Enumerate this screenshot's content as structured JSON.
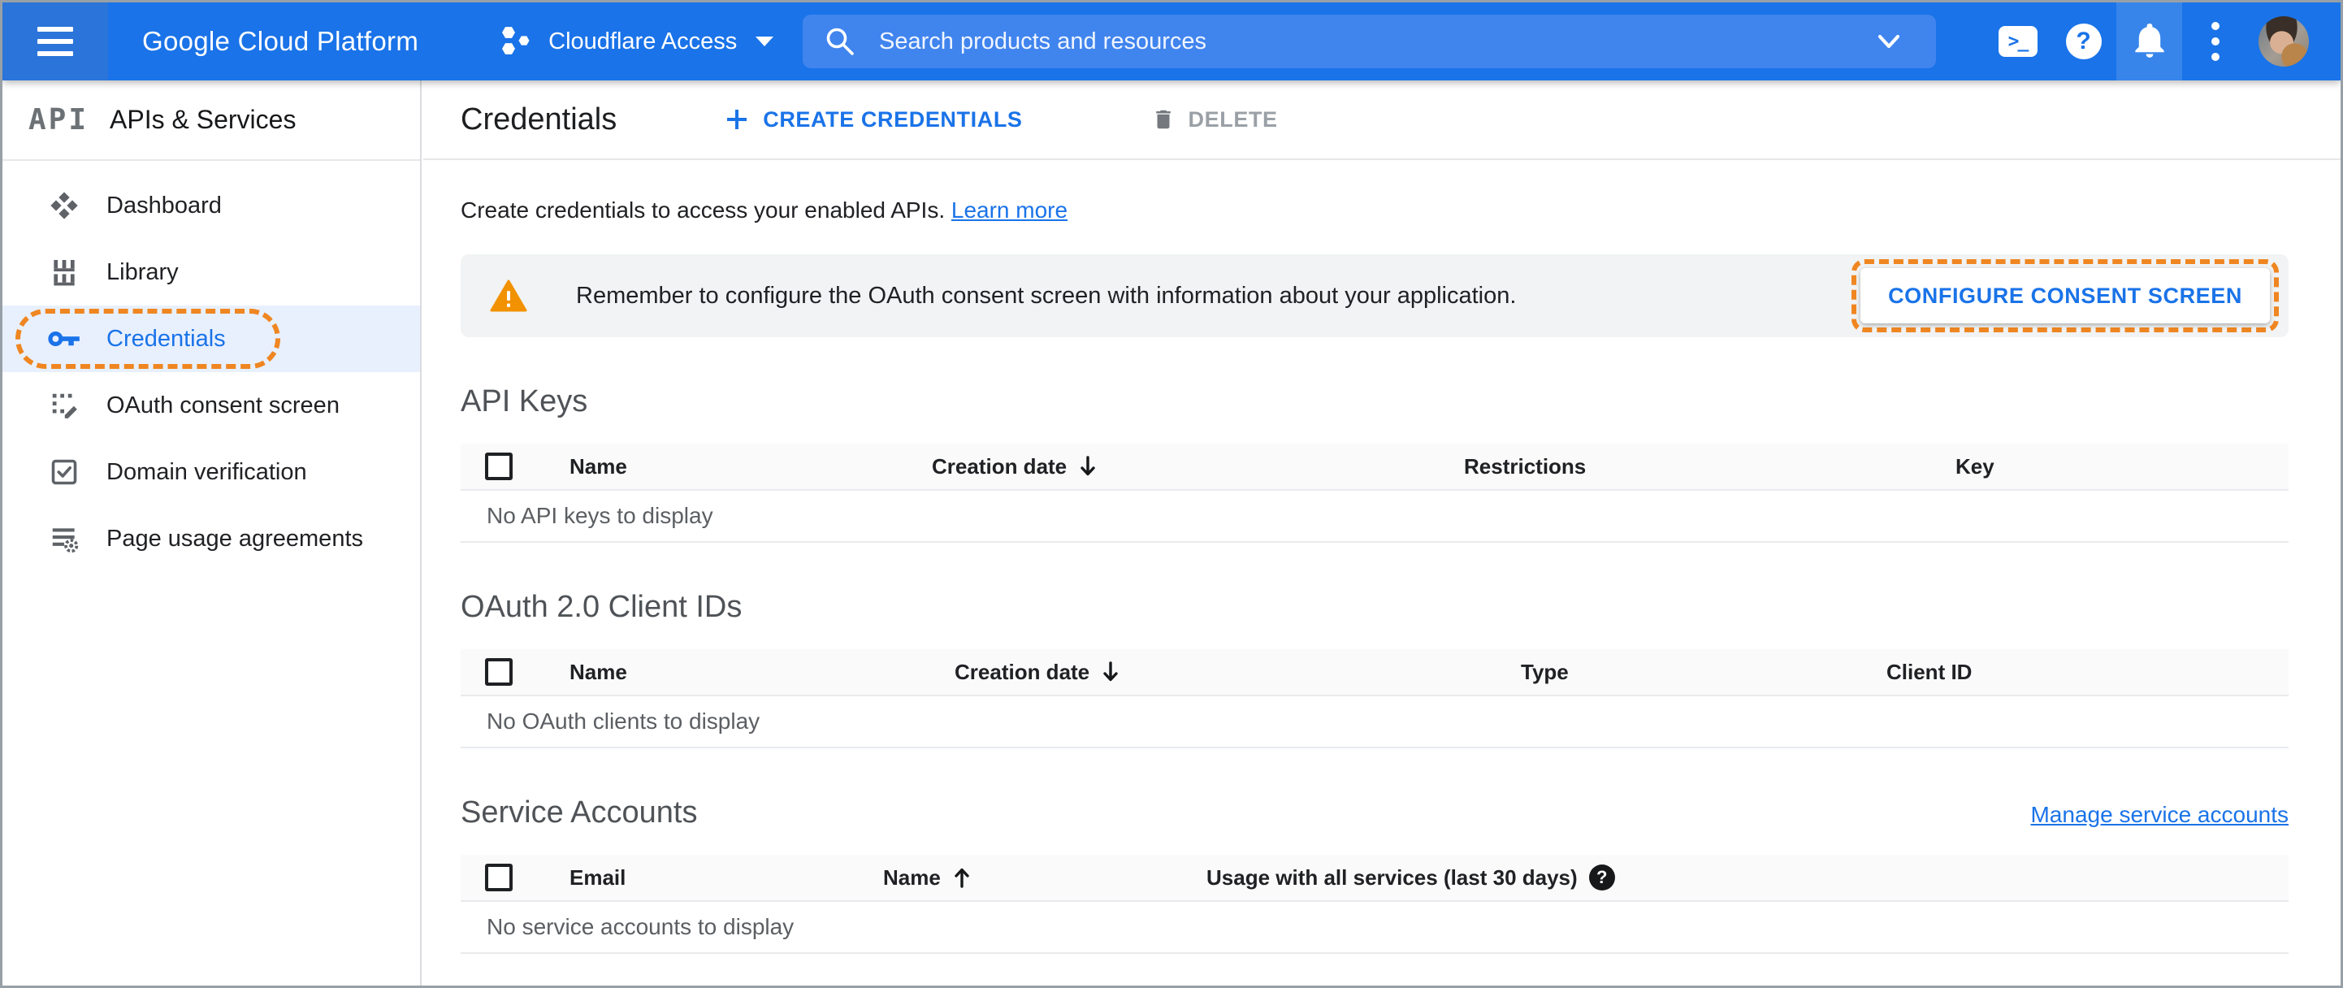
{
  "topbar": {
    "app_title": "Google Cloud Platform",
    "project_name": "Cloudflare Access",
    "search_placeholder": "Search products and resources",
    "shell_glyph": ">_",
    "help_glyph": "?"
  },
  "sidebar": {
    "logo_text": "API",
    "product_name": "APIs & Services",
    "items": [
      {
        "label": "Dashboard",
        "icon": "dashboard-icon",
        "active": false
      },
      {
        "label": "Library",
        "icon": "library-icon",
        "active": false
      },
      {
        "label": "Credentials",
        "icon": "key-icon",
        "active": true,
        "tutorial_highlight": true
      },
      {
        "label": "OAuth consent screen",
        "icon": "consent-screen-icon",
        "active": false
      },
      {
        "label": "Domain verification",
        "icon": "domain-verification-icon",
        "active": false
      },
      {
        "label": "Page usage agreements",
        "icon": "agreements-icon",
        "active": false
      }
    ]
  },
  "page": {
    "title": "Credentials",
    "create_button": "CREATE CREDENTIALS",
    "delete_button": "DELETE",
    "intro_text": "Create credentials to access your enabled APIs.",
    "intro_link": "Learn more",
    "warning": {
      "message": "Remember to configure the OAuth consent screen with information about your application.",
      "action_button": "CONFIGURE CONSENT SCREEN"
    }
  },
  "sections": {
    "api_keys": {
      "title": "API Keys",
      "columns": [
        "Name",
        "Creation date",
        "Restrictions",
        "Key"
      ],
      "sort_column": "Creation date",
      "sort_direction": "desc",
      "empty_text": "No API keys to display"
    },
    "oauth_clients": {
      "title": "OAuth 2.0 Client IDs",
      "columns": [
        "Name",
        "Creation date",
        "Type",
        "Client ID"
      ],
      "sort_column": "Creation date",
      "sort_direction": "desc",
      "empty_text": "No OAuth clients to display"
    },
    "service_accounts": {
      "title": "Service Accounts",
      "manage_link": "Manage service accounts",
      "columns": [
        "Email",
        "Name",
        "Usage with all services (last 30 days)"
      ],
      "sort_column": "Name",
      "sort_direction": "asc",
      "empty_text": "No service accounts to display",
      "help_glyph": "?"
    }
  },
  "icons": {
    "menu-icon": "hamburger bars",
    "project-icon": "three hexagons",
    "search-icon": "magnifier",
    "search-expand-icon": "chevron-down",
    "cloud-shell-icon": "terminal prompt in rounded square",
    "help-icon": "question mark in circle",
    "notifications-icon": "bell",
    "more-options-icon": "vertical dots",
    "warning-icon": "orange triangle with exclamation",
    "sort-desc-icon": "down arrow",
    "sort-asc-icon": "up arrow"
  },
  "colors": {
    "topbar_bg": "#1a73e8",
    "topbar_drawer_bg": "#2b74d9",
    "search_bg": "#4084ee",
    "accent_blue": "#1a73e8",
    "tutorial_orange": "#ef8621",
    "warning_orange": "#f29200",
    "active_nav_bg": "#e8f0fe",
    "banner_bg": "#f1f3f4",
    "table_header_bg": "#fafafa"
  }
}
